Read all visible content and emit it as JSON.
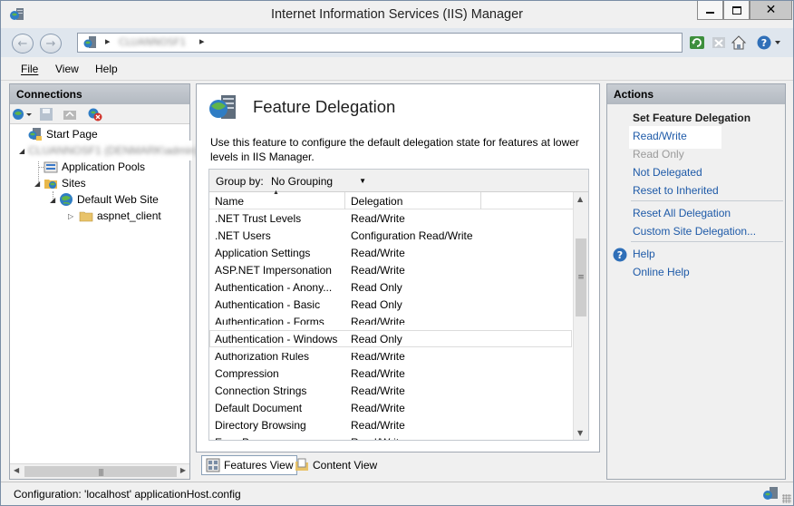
{
  "window": {
    "title": "Internet Information Services (IIS) Manager",
    "close_glyph": "✕"
  },
  "address": {
    "host": "CLUANNOSF1",
    "chevron": "▸"
  },
  "menu": {
    "file": "File",
    "view": "View",
    "help": "Help"
  },
  "connections": {
    "title": "Connections",
    "tree": {
      "start_page": "Start Page",
      "server": "CLUANNOSF1 (DENMARK\\admin)",
      "app_pools": "Application Pools",
      "sites": "Sites",
      "default_site": "Default Web Site",
      "aspnet_client": "aspnet_client"
    }
  },
  "center": {
    "title": "Feature Delegation",
    "description": "Use this feature to configure the default delegation state for features at lower levels in IIS Manager.",
    "group_by_label": "Group by:",
    "group_by_value": "No Grouping",
    "columns": {
      "name": "Name",
      "delegation": "Delegation"
    },
    "rows": [
      {
        "name": ".NET Trust Levels",
        "delegation": "Read/Write"
      },
      {
        "name": ".NET Users",
        "delegation": "Configuration Read/Write"
      },
      {
        "name": "Application Settings",
        "delegation": "Read/Write"
      },
      {
        "name": "ASP.NET Impersonation",
        "delegation": "Read/Write"
      },
      {
        "name": "Authentication - Anony...",
        "delegation": "Read Only"
      },
      {
        "name": "Authentication - Basic",
        "delegation": "Read Only"
      },
      {
        "name": "Authentication - Forms",
        "delegation": "Read/Write"
      },
      {
        "name": "Authentication - Windows",
        "delegation": "Read Only"
      },
      {
        "name": "Authorization Rules",
        "delegation": "Read/Write"
      },
      {
        "name": "Compression",
        "delegation": "Read/Write"
      },
      {
        "name": "Connection Strings",
        "delegation": "Read/Write"
      },
      {
        "name": "Default Document",
        "delegation": "Read/Write"
      },
      {
        "name": "Directory Browsing",
        "delegation": "Read/Write"
      },
      {
        "name": "Error Pages",
        "delegation": "Read/Write"
      }
    ],
    "selected_row_index": 7,
    "views": {
      "features": "Features View",
      "content": "Content View"
    }
  },
  "actions": {
    "title": "Actions",
    "set_feature_delegation": "Set Feature Delegation",
    "read_write": "Read/Write",
    "read_only": "Read Only",
    "not_delegated": "Not Delegated",
    "reset_inherited": "Reset to Inherited",
    "reset_all": "Reset All Delegation",
    "custom_site": "Custom Site Delegation...",
    "help": "Help",
    "online_help": "Online Help"
  },
  "status": {
    "text": "Configuration: 'localhost' applicationHost.config"
  },
  "colors": {
    "link": "#1e5aa8",
    "disabled": "#9a9a9a",
    "panel_header": "#b8bec6",
    "address_bar": "#dfe6ee"
  }
}
